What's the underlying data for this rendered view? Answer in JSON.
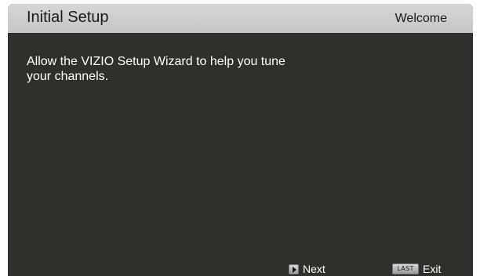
{
  "header": {
    "title": "Initial Setup",
    "step": "Welcome"
  },
  "main": {
    "message": "Allow the VIZIO Setup Wizard to help you tune your channels."
  },
  "footer": {
    "next": {
      "icon": "play-key-icon",
      "label": "Next"
    },
    "exit": {
      "icon": "last-key-icon",
      "key_text": "LAST",
      "label": "Exit"
    }
  },
  "colors": {
    "panel_background": "#2f2f2e",
    "header_background": "#d0d0d0",
    "text_light": "#ffffff",
    "text_dark": "#1a1a1a"
  }
}
